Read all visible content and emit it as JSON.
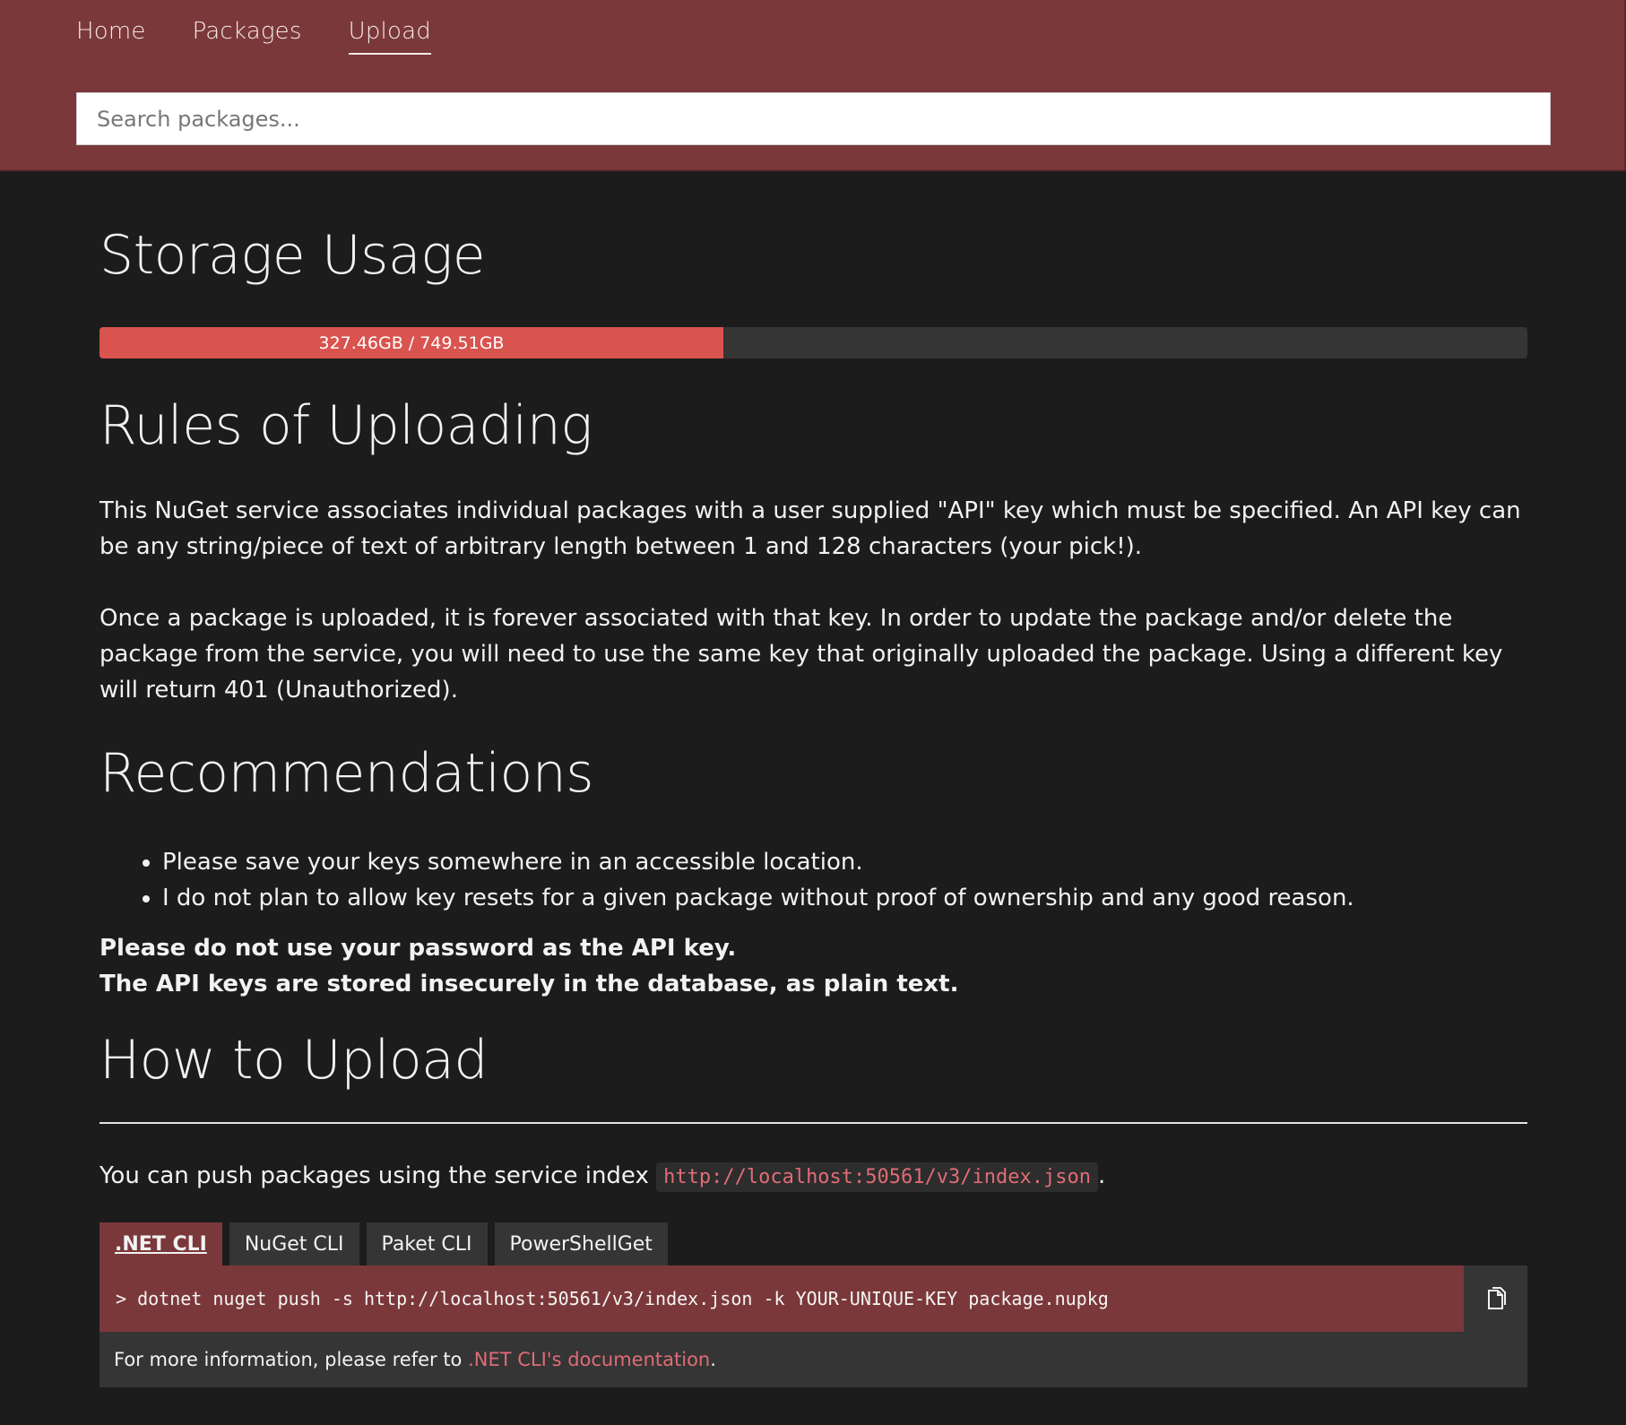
{
  "colors": {
    "brand": "#7b383a",
    "danger": "#d9534f",
    "code": "#e06c75"
  },
  "nav": {
    "items": [
      {
        "label": "Home"
      },
      {
        "label": "Packages"
      },
      {
        "label": "Upload",
        "active": true
      }
    ]
  },
  "search": {
    "placeholder": "Search packages..."
  },
  "storage": {
    "title": "Storage Usage",
    "label": "327.46GB / 749.51GB",
    "used_fraction": 0.4369
  },
  "rules": {
    "title": "Rules of Uploading",
    "p1": "This NuGet service associates individual packages with a user supplied \"API\" key which must be specified. An API key can be any string/piece of text of arbitrary length between 1 and 128 characters (your pick!).",
    "p2": "Once a package is uploaded, it is forever associated with that key. In order to update the package and/or delete the package from the service, you will need to use the same key that originally uploaded the package. Using a different key will return 401 (Unauthorized)."
  },
  "recommendations": {
    "title": "Recommendations",
    "items": [
      "Please save your keys somewhere in an accessible location.",
      "I do not plan to allow key resets for a given package without proof of ownership and any good reason."
    ],
    "warning_line1": "Please do not use your password as the API key.",
    "warning_line2": "The API keys are stored insecurely in the database, as plain text."
  },
  "how": {
    "title": "How to Upload",
    "push_text": "You can push packages using the service index",
    "service_index": "http://localhost:50561/v3/index.json",
    "push_suffix": ".",
    "tabs": [
      {
        "label": ".NET CLI",
        "active": true
      },
      {
        "label": "NuGet CLI"
      },
      {
        "label": "Paket CLI"
      },
      {
        "label": "PowerShellGet"
      }
    ],
    "command": "> dotnet nuget push -s http://localhost:50561/v3/index.json -k YOUR-UNIQUE-KEY package.nupkg",
    "info_prefix": "For more information, please refer to ",
    "info_link": ".NET CLI's documentation",
    "info_suffix": ".",
    "copy_icon": "copy-icon"
  }
}
